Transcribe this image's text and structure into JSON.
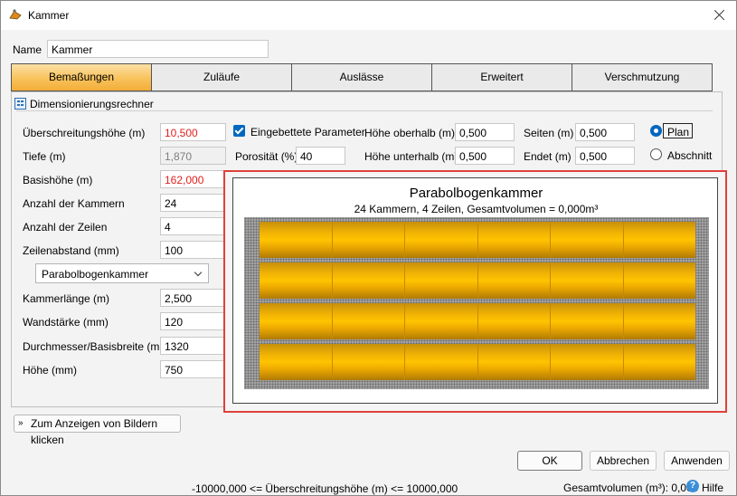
{
  "window": {
    "title": "Kammer"
  },
  "name_field": {
    "label": "Name",
    "value": "Kammer"
  },
  "tabs": [
    {
      "label": "Bemaßungen",
      "active": true
    },
    {
      "label": "Zuläufe",
      "active": false
    },
    {
      "label": "Auslässe",
      "active": false
    },
    {
      "label": "Erweitert",
      "active": false
    },
    {
      "label": "Verschmutzung",
      "active": false
    }
  ],
  "section": {
    "title": "Dimensionierungsrechner"
  },
  "left_fields": [
    {
      "label": "Überschreitungshöhe (m)",
      "value": "10,500"
    },
    {
      "label": "Tiefe (m)",
      "value": "1,870"
    },
    {
      "label": "Basishöhe (m)",
      "value": "162,000"
    },
    {
      "label": "Anzahl der Kammern",
      "value": "24"
    },
    {
      "label": "Anzahl der Zeilen",
      "value": "4"
    },
    {
      "label": "Zeilenabstand (mm)",
      "value": "100"
    },
    {
      "label": "Kammerlänge (m)",
      "value": "2,500"
    },
    {
      "label": "Wandstärke (mm)",
      "value": "120"
    },
    {
      "label": "Durchmesser/Basisbreite (mm)",
      "value": "1320"
    },
    {
      "label": "Höhe (mm)",
      "value": "750"
    }
  ],
  "chamber_type": {
    "selected": "Parabolbogenkammer"
  },
  "embedded": {
    "label": "Eingebettete Parameter",
    "checked": true
  },
  "porosity": {
    "label": "Porosität (%)",
    "value": "40"
  },
  "height_above": {
    "label": "Höhe oberhalb (m)",
    "value": "0,500"
  },
  "height_below": {
    "label": "Höhe unterhalb (m)",
    "value": "0,500"
  },
  "sides": {
    "label": "Seiten (m)",
    "value": "0,500"
  },
  "ends": {
    "label": "Endet (m)",
    "value": "0,500"
  },
  "view_mode": {
    "plan": "Plan",
    "section": "Abschnitt",
    "selected": "Plan"
  },
  "preview": {
    "title": "Parabolbogenkammer",
    "subtitle": "24 Kammern, 4 Zeilen, Gesamtvolumen = 0,000m³",
    "rows": 4,
    "chambers_per_row": 6
  },
  "show_images_button": "Zum Anzeigen von Bildern klicken",
  "buttons": {
    "ok": "OK",
    "cancel": "Abbrechen",
    "apply": "Anwenden"
  },
  "status": {
    "range_hint": "-10000,000 <= Überschreitungshöhe (m) <= 10000,000",
    "total_volume": "Gesamtvolumen (m³): 0,000",
    "help": "Hilfe"
  },
  "colors": {
    "tab_active": "#f6b847",
    "error_text": "#e0201c",
    "accent": "#0067c0",
    "highlight_border": "#e0403a",
    "chamber": "#f1b304"
  }
}
